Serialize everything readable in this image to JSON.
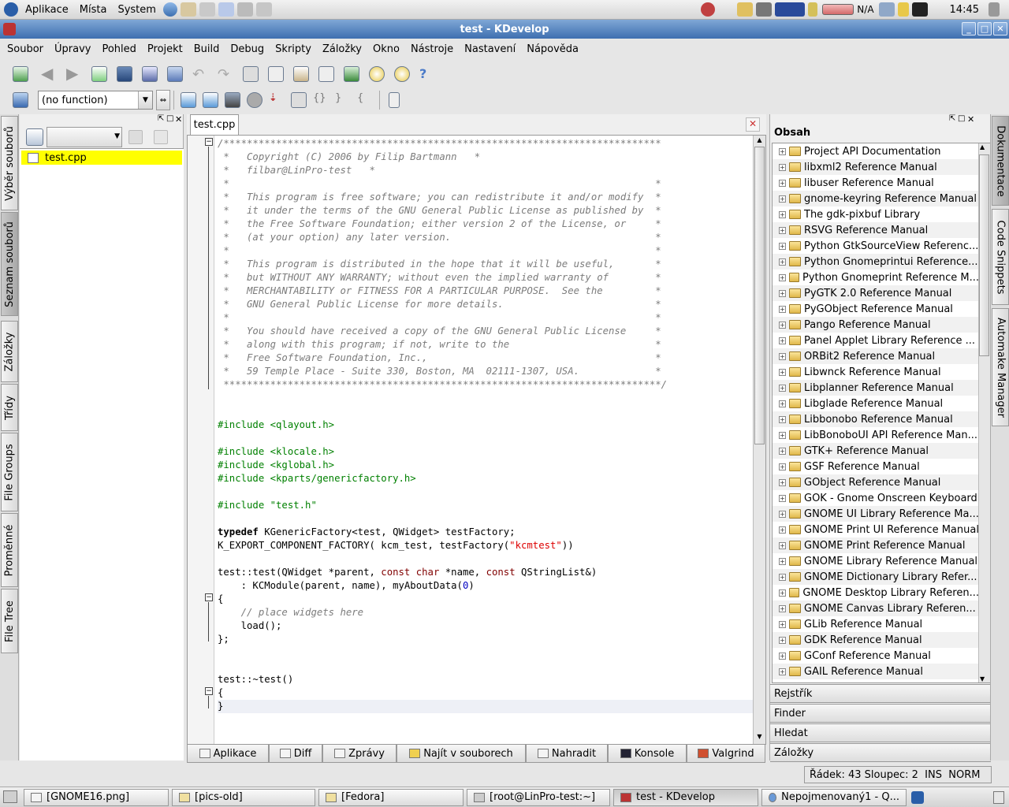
{
  "gnome_panel": {
    "menus": [
      "Aplikace",
      "Místa",
      "System"
    ],
    "status": {
      "battery": "N/A",
      "clock": "14:45"
    }
  },
  "window": {
    "title": "test - KDevelop"
  },
  "menubar": [
    "Soubor",
    "Úpravy",
    "Pohled",
    "Projekt",
    "Build",
    "Debug",
    "Skripty",
    "Záložky",
    "Okno",
    "Nástroje",
    "Nastavení",
    "Nápověda"
  ],
  "toolbar2": {
    "function_combo": "(no function)"
  },
  "left_tabs": [
    "Výběr souborů",
    "Seznam souborů",
    "Záložky",
    "Třídy",
    "File Groups",
    "Proměnné",
    "File Tree"
  ],
  "file_list": {
    "items": [
      "test.cpp"
    ]
  },
  "editor": {
    "tab": "test.cpp",
    "lines": [
      "/***************************************************************************",
      " *   Copyright (C) 2006 by Filip Bartmann   *",
      " *   filbar@LinPro-test   *",
      " *                                                                         *",
      " *   This program is free software; you can redistribute it and/or modify  *",
      " *   it under the terms of the GNU General Public License as published by  *",
      " *   the Free Software Foundation; either version 2 of the License, or     *",
      " *   (at your option) any later version.                                   *",
      " *                                                                         *",
      " *   This program is distributed in the hope that it will be useful,       *",
      " *   but WITHOUT ANY WARRANTY; without even the implied warranty of        *",
      " *   MERCHANTABILITY or FITNESS FOR A PARTICULAR PURPOSE.  See the         *",
      " *   GNU General Public License for more details.                          *",
      " *                                                                         *",
      " *   You should have received a copy of the GNU General Public License     *",
      " *   along with this program; if not, write to the                         *",
      " *   Free Software Foundation, Inc.,                                       *",
      " *   59 Temple Place - Suite 330, Boston, MA  02111-1307, USA.             *",
      " ***************************************************************************/",
      "",
      "",
      "#include <qlayout.h>",
      "",
      "#include <klocale.h>",
      "#include <kglobal.h>",
      "#include <kparts/genericfactory.h>",
      "",
      "#include \"test.h\"",
      "",
      "typedef KGenericFactory<test, QWidget> testFactory;",
      "K_EXPORT_COMPONENT_FACTORY( kcm_test, testFactory(\"kcmtest\"))",
      "",
      "test::test(QWidget *parent, const char *name, const QStringList&)",
      "    : KCModule(parent, name), myAboutData(0)",
      "{",
      "    // place widgets here",
      "    load();",
      "};",
      "",
      "",
      "test::~test()",
      "{",
      "}"
    ]
  },
  "bottom_tabs": [
    "Aplikace",
    "Diff",
    "Zprávy",
    "Najít v souborech",
    "Nahradit",
    "Konsole",
    "Valgrind"
  ],
  "doc_panel": {
    "header": "Obsah",
    "items": [
      "Project API Documentation",
      "libxml2 Reference Manual",
      "libuser Reference Manual",
      "gnome-keyring Reference Manual",
      "The gdk-pixbuf Library",
      "RSVG Reference Manual",
      "Python GtkSourceView Referenc...",
      "Python Gnomeprintui Reference...",
      "Python Gnomeprint Reference M...",
      "PyGTK 2.0 Reference Manual",
      "PyGObject Reference Manual",
      "Pango Reference Manual",
      "Panel Applet Library Reference ...",
      "ORBit2 Reference Manual",
      "Libwnck Reference Manual",
      "Libplanner Reference Manual",
      "Libglade Reference Manual",
      "Libbonobo Reference Manual",
      "LibBonoboUI API Reference Man...",
      "GTK+ Reference Manual",
      "GSF Reference Manual",
      "GObject Reference Manual",
      "GOK - Gnome Onscreen Keyboard",
      "GNOME UI Library Reference Ma...",
      "GNOME Print UI Reference Manual",
      "GNOME Print Reference Manual",
      "GNOME Library Reference Manual",
      "GNOME Dictionary Library Refer...",
      "GNOME Desktop Library Referen...",
      "GNOME Canvas Library Referen...",
      "GLib Reference Manual",
      "GDK Reference Manual",
      "GConf Reference Manual",
      "GAIL Reference Manual"
    ],
    "sections": [
      "Rejstřík",
      "Finder",
      "Hledat",
      "Záložky"
    ]
  },
  "right_tabs": [
    "Dokumentace",
    "Code Snippets",
    "Automake Manager"
  ],
  "statusbar": {
    "text": "Řádek: 43 Sloupec: 2  INS  NORM"
  },
  "taskbar": [
    "[GNOME16.png]",
    "[pics-old]",
    "[Fedora]",
    "[root@LinPro-test:~]",
    "test - KDevelop",
    "Nepojmenovaný1 - Q..."
  ]
}
